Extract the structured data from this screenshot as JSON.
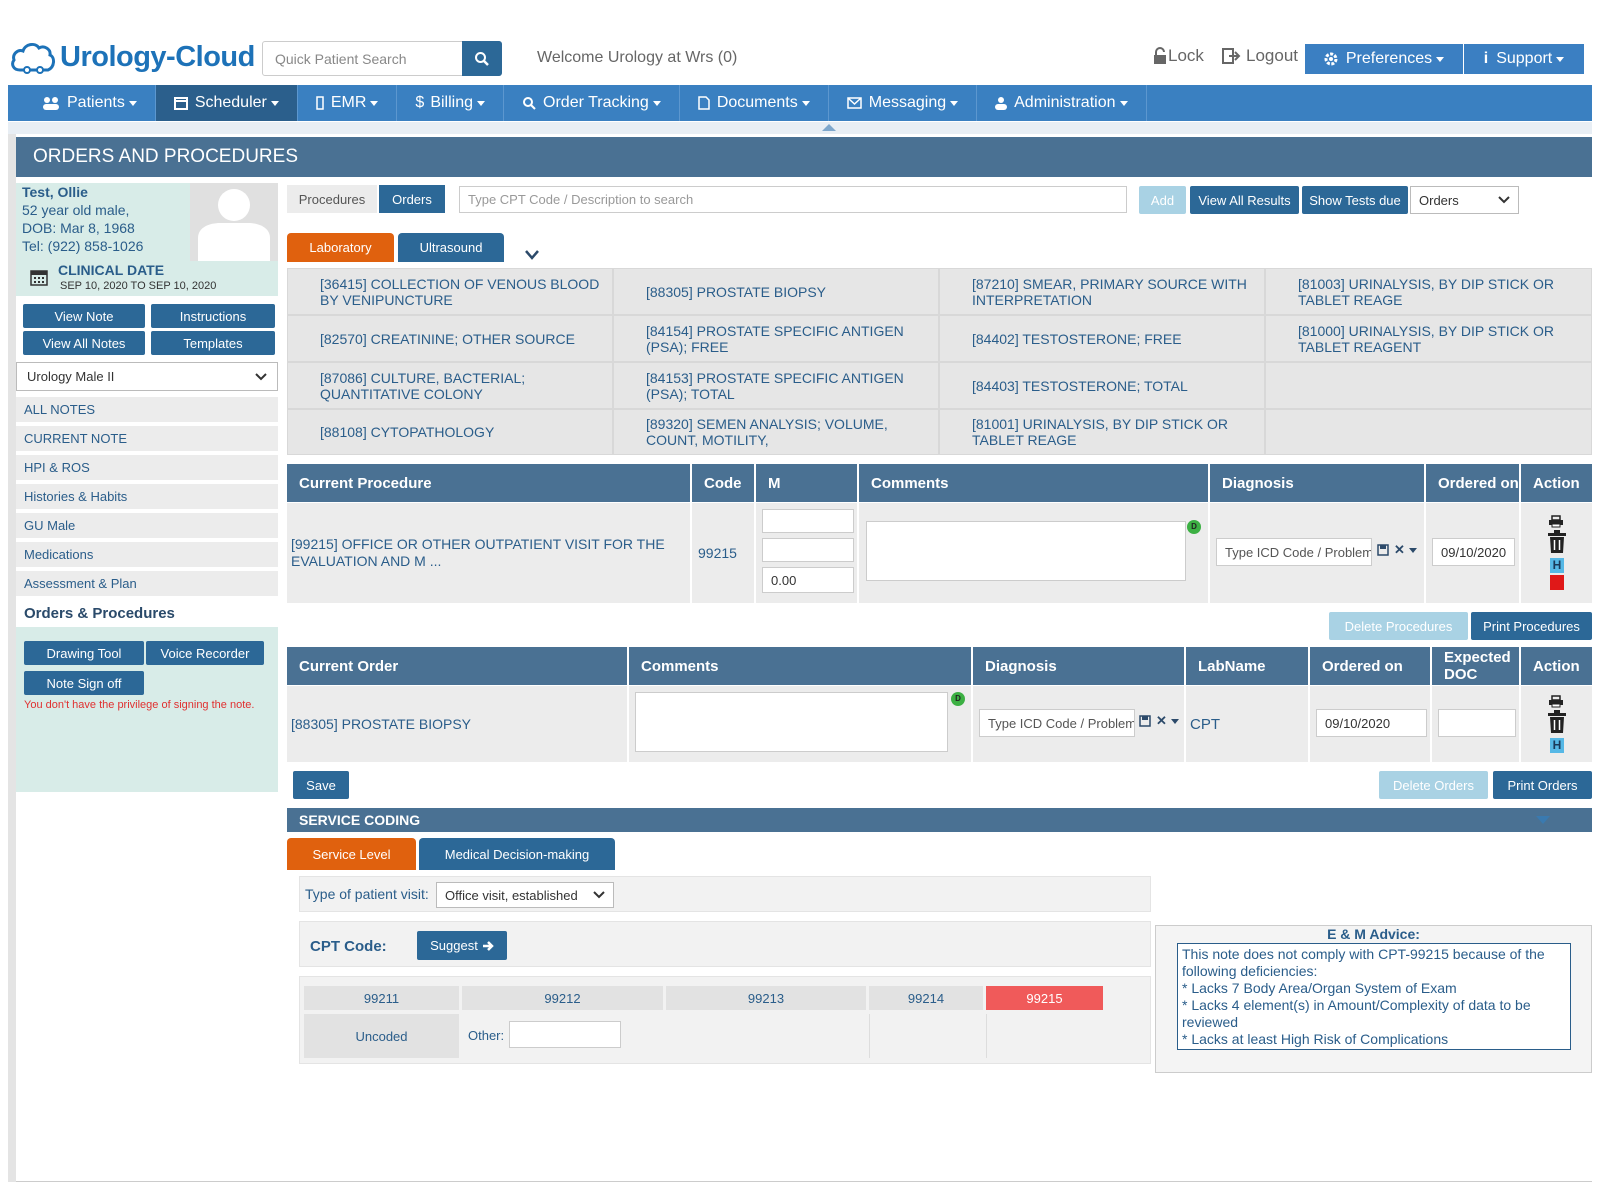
{
  "header": {
    "logo": "Urology-Cloud",
    "search_placeholder": "Quick Patient Search",
    "welcome": "Welcome Urology at Wrs (0)",
    "lock": "Lock",
    "logout": "Logout",
    "preferences": "Preferences",
    "support": "Support"
  },
  "nav": [
    "Patients",
    "Scheduler",
    "EMR",
    "Billing",
    "Order Tracking",
    "Documents",
    "Messaging",
    "Administration"
  ],
  "page_title": "ORDERS AND PROCEDURES",
  "patient": {
    "name": "Test, Ollie",
    "age_sex": "52 year old male,",
    "dob": "DOB: Mar 8, 1968",
    "tel": "Tel: (922) 858-1026",
    "clinical_date_label": "CLINICAL DATE",
    "clinical_date_range": "SEP 10, 2020 TO SEP 10, 2020"
  },
  "left_buttons": {
    "view_note": "View Note",
    "instructions": "Instructions",
    "view_all_notes": "View All Notes",
    "templates": "Templates"
  },
  "template_select": "Urology Male II",
  "left_nav": [
    "ALL NOTES",
    "CURRENT NOTE",
    "HPI & ROS",
    "Histories & Habits",
    "GU Male",
    "Medications",
    "Assessment & Plan"
  ],
  "left_nav_active": "Orders & Procedures",
  "tools": {
    "drawing": "Drawing Tool",
    "voice": "Voice Recorder",
    "signoff": "Note Sign off",
    "privilege": "You don't have the privilege of signing the note."
  },
  "toolbar": {
    "procedures_tab": "Procedures",
    "orders_tab": "Orders",
    "cpt_placeholder": "Type CPT Code / Description to search",
    "add": "Add",
    "view_all_results": "View All Results",
    "show_tests_due": "Show Tests due",
    "orders_select": "Orders"
  },
  "subtabs": {
    "laboratory": "Laboratory",
    "ultrasound": "Ultrasound"
  },
  "labs": [
    [
      "[36415] COLLECTION OF VENOUS BLOOD BY VENIPUNCTURE",
      "[88305] PROSTATE BIOPSY",
      "[87210] SMEAR, PRIMARY SOURCE WITH INTERPRETATION",
      "[81003] URINALYSIS, BY DIP STICK OR TABLET REAGE"
    ],
    [
      "[82570] CREATININE; OTHER SOURCE",
      "[84154] PROSTATE SPECIFIC ANTIGEN (PSA); FREE",
      "[84402] TESTOSTERONE; FREE",
      "[81000] URINALYSIS, BY DIP STICK OR TABLET REAGENT"
    ],
    [
      "[87086] CULTURE, BACTERIAL; QUANTITATIVE COLONY",
      "[84153] PROSTATE SPECIFIC ANTIGEN (PSA); TOTAL",
      "[84403] TESTOSTERONE; TOTAL",
      ""
    ],
    [
      "[88108] CYTOPATHOLOGY",
      "[89320] SEMEN ANALYSIS; VOLUME, COUNT, MOTILITY,",
      "[81001] URINALYSIS, BY DIP STICK OR TABLET REAGE",
      ""
    ]
  ],
  "procedure_table": {
    "headers": [
      "Current Procedure",
      "Code",
      "M",
      "Comments",
      "Diagnosis",
      "Ordered on",
      "Action"
    ],
    "row": {
      "name": "[99215] OFFICE OR OTHER OUTPATIENT VISIT FOR THE EVALUATION AND M ...",
      "code": "99215",
      "m3": "0.00",
      "diagnosis_placeholder": "Type ICD Code / Problem",
      "ordered_on": "09/10/2020",
      "h": "H"
    },
    "delete": "Delete Procedures",
    "print": "Print Procedures"
  },
  "order_table": {
    "headers": [
      "Current Order",
      "Comments",
      "Diagnosis",
      "LabName",
      "Ordered on",
      "Expected DOC",
      "Action"
    ],
    "row": {
      "name": "[88305] PROSTATE BIOPSY",
      "diagnosis_placeholder": "Type ICD Code / Problem",
      "labname": "CPT",
      "ordered_on": "09/10/2020",
      "h": "H"
    },
    "save": "Save",
    "delete": "Delete Orders",
    "print": "Print Orders"
  },
  "service_coding": {
    "title": "SERVICE CODING",
    "tab_service": "Service Level",
    "tab_mdm": "Medical Decision-making",
    "visit_label": "Type of patient visit:",
    "visit_value": "Office visit, established",
    "cpt_label": "CPT Code:",
    "suggest": "Suggest",
    "codes": [
      "99211",
      "99212",
      "99213",
      "99214",
      "99215"
    ],
    "uncoded": "Uncoded",
    "other": "Other:",
    "advice_title": "E & M Advice:",
    "advice_lines": [
      "This note does not comply with CPT-99215 because of the following deficiencies:",
      "* Lacks 7 Body Area/Organ System of Exam",
      "* Lacks 4 element(s) in Amount/Complexity of data to be reviewed",
      "* Lacks at least High Risk of Complications"
    ]
  },
  "colors": {
    "nav": "#3a80c1",
    "header_bar": "#4a7193",
    "button": "#2c6897",
    "orange_tab": "#e0610e",
    "highlight_code": "#f05a5a",
    "patient_bg": "#d8ece8"
  }
}
